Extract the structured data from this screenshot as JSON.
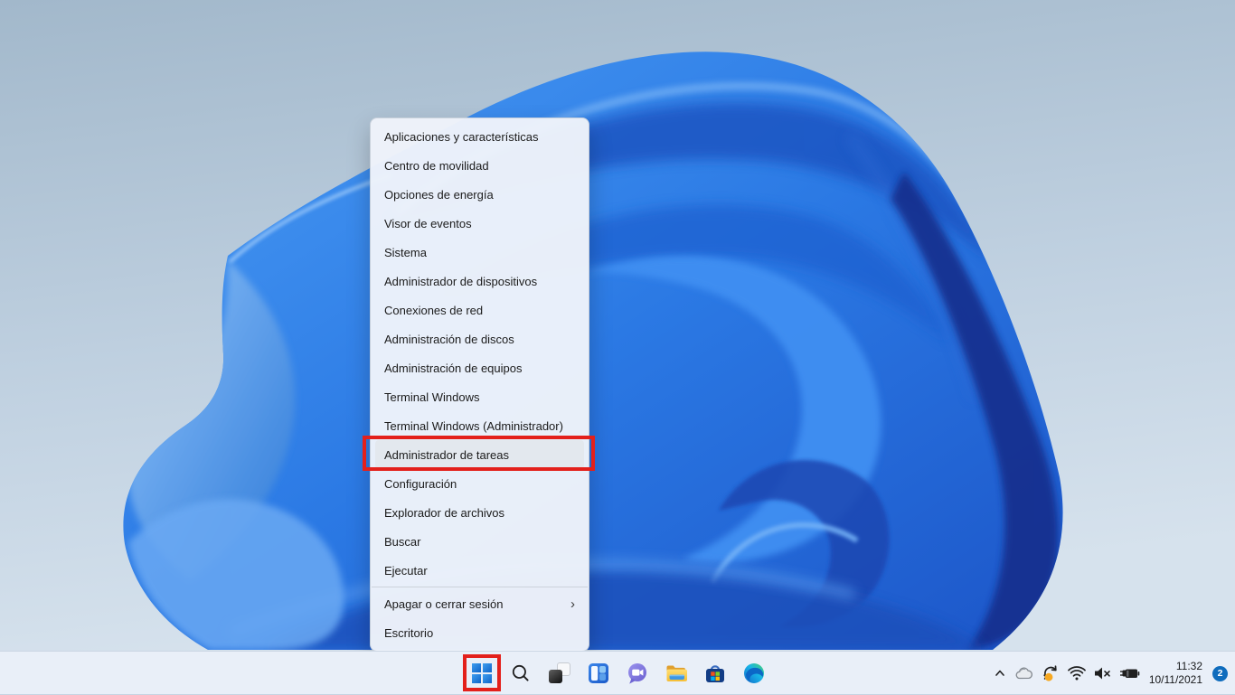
{
  "wallpaper": {
    "sky_top": "#a2b8cb",
    "sky_bottom": "#d6e2ed",
    "bloom_primary": "#2b79e4",
    "bloom_deep": "#142f8c",
    "bloom_light": "#8ec2fa"
  },
  "context_menu": {
    "submenu_arrow": "›",
    "items": [
      {
        "label": "Aplicaciones y características"
      },
      {
        "label": "Centro de movilidad"
      },
      {
        "label": "Opciones de energía"
      },
      {
        "label": "Visor de eventos"
      },
      {
        "label": "Sistema"
      },
      {
        "label": "Administrador de dispositivos"
      },
      {
        "label": "Conexiones de red"
      },
      {
        "label": "Administración de discos"
      },
      {
        "label": "Administración de equipos"
      },
      {
        "label": "Terminal Windows"
      },
      {
        "label": "Terminal Windows (Administrador)"
      },
      {
        "label": "Administrador de tareas",
        "highlighted": true
      },
      {
        "label": "Configuración"
      },
      {
        "label": "Explorador de archivos"
      },
      {
        "label": "Buscar"
      },
      {
        "label": "Ejecutar"
      },
      {
        "label": "Apagar o cerrar sesión",
        "has_submenu": true
      },
      {
        "label": "Escritorio"
      }
    ]
  },
  "annotations": {
    "box_color": "#e3201b",
    "highlighted_targets": [
      "task-manager-menu-item",
      "start-button"
    ]
  },
  "taskbar": {
    "icons": [
      {
        "name": "start"
      },
      {
        "name": "search"
      },
      {
        "name": "task-view"
      },
      {
        "name": "widgets"
      },
      {
        "name": "chat"
      },
      {
        "name": "file-explorer"
      },
      {
        "name": "microsoft-store"
      },
      {
        "name": "edge"
      }
    ],
    "tray": {
      "icons": [
        {
          "name": "hidden-icons-chevron"
        },
        {
          "name": "onedrive"
        },
        {
          "name": "update-pending"
        },
        {
          "name": "wifi"
        },
        {
          "name": "volume-muted"
        },
        {
          "name": "battery-charging"
        }
      ],
      "badge_count": "2",
      "badge_color": "#0f6cbd"
    },
    "clock": {
      "time": "11:32",
      "date": "10/11/2021"
    }
  }
}
